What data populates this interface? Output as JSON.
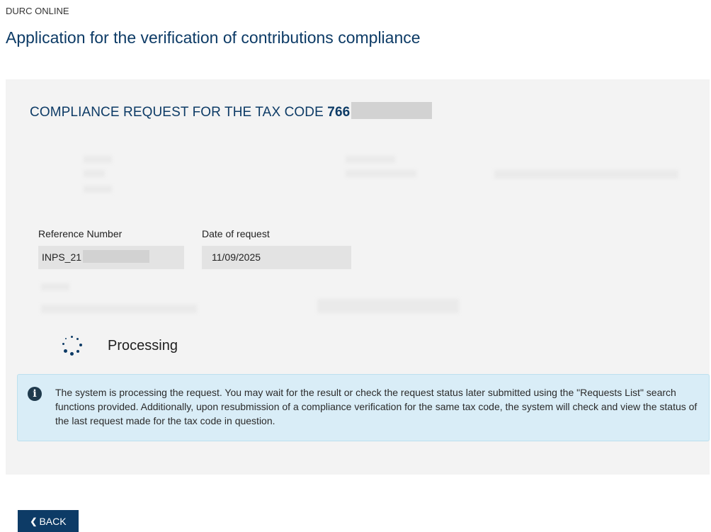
{
  "header": {
    "breadcrumb": "DURC ONLINE",
    "title": "Application for the verification of contributions compliance"
  },
  "panel": {
    "title_prefix": "COMPLIANCE REQUEST FOR THE TAX CODE",
    "tax_code_visible": "766",
    "fields": {
      "reference_number": {
        "label": "Reference Number",
        "value_visible": "INPS_21"
      },
      "date_of_request": {
        "label": "Date of request",
        "value": "11/09/2025"
      }
    },
    "processing_label": "Processing",
    "info_message": "The system is processing the request. You may wait for the result or check the request status later submitted using the \"Requests List\" search functions provided. Additionally, upon resubmission of a compliance verification for the same tax code, the system will check and view the status of the last request made for the tax code in question."
  },
  "actions": {
    "back_label": "BACK"
  },
  "icons": {
    "info": "info-icon",
    "spinner": "spinner-icon",
    "back_chevron": "chevron-left-icon"
  },
  "colors": {
    "primary": "#0d3b66",
    "panel_bg": "#f3f3f3",
    "info_bg": "#d9edf7",
    "field_bg": "#e3e3e3",
    "redaction": "#d2d2d2"
  }
}
